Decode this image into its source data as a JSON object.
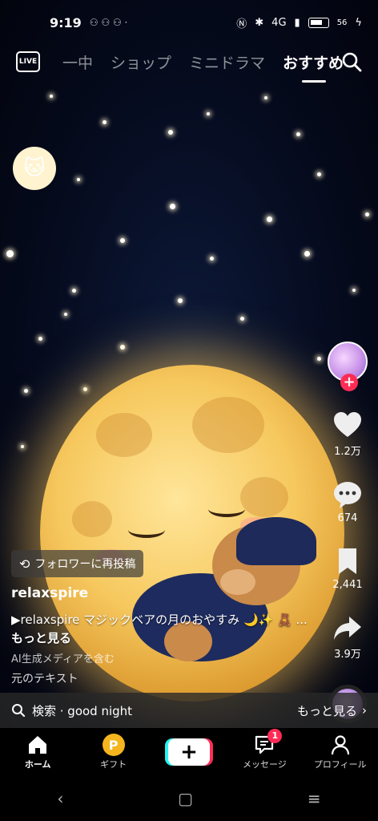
{
  "status": {
    "time": "9:19",
    "notif_icons": "⚇ ⚇ ⚇ ·",
    "network": "4G",
    "battery": "56"
  },
  "topnav": {
    "live_label": "LIVE",
    "tabs": [
      {
        "label": "一中"
      },
      {
        "label": "ショップ"
      },
      {
        "label": "ミニドラマ"
      },
      {
        "label": "おすすめ"
      }
    ]
  },
  "actions": {
    "likes": "1.2万",
    "comments": "674",
    "bookmarks": "2,441",
    "shares": "3.9万"
  },
  "video": {
    "repost_label": "フォロワーに再投稿",
    "username": "relaxspire",
    "caption": "▶relaxspire マジックベアの月のおやすみ 🌙✨ 🧸 ...",
    "more_label": "もっと見る",
    "ai_label": "AI生成メディアを含む",
    "original_text": "元のテキスト"
  },
  "search": {
    "query": "検索 · good night",
    "more": "もっと見る"
  },
  "tabbar": {
    "home": "ホーム",
    "gift": "ギフト",
    "messages": "メッセージ",
    "messages_count": "1",
    "profile": "プロフィール"
  },
  "colors": {
    "accent": "#fe2c55",
    "cyan": "#25f4ee",
    "moon": "#f6c85e"
  }
}
